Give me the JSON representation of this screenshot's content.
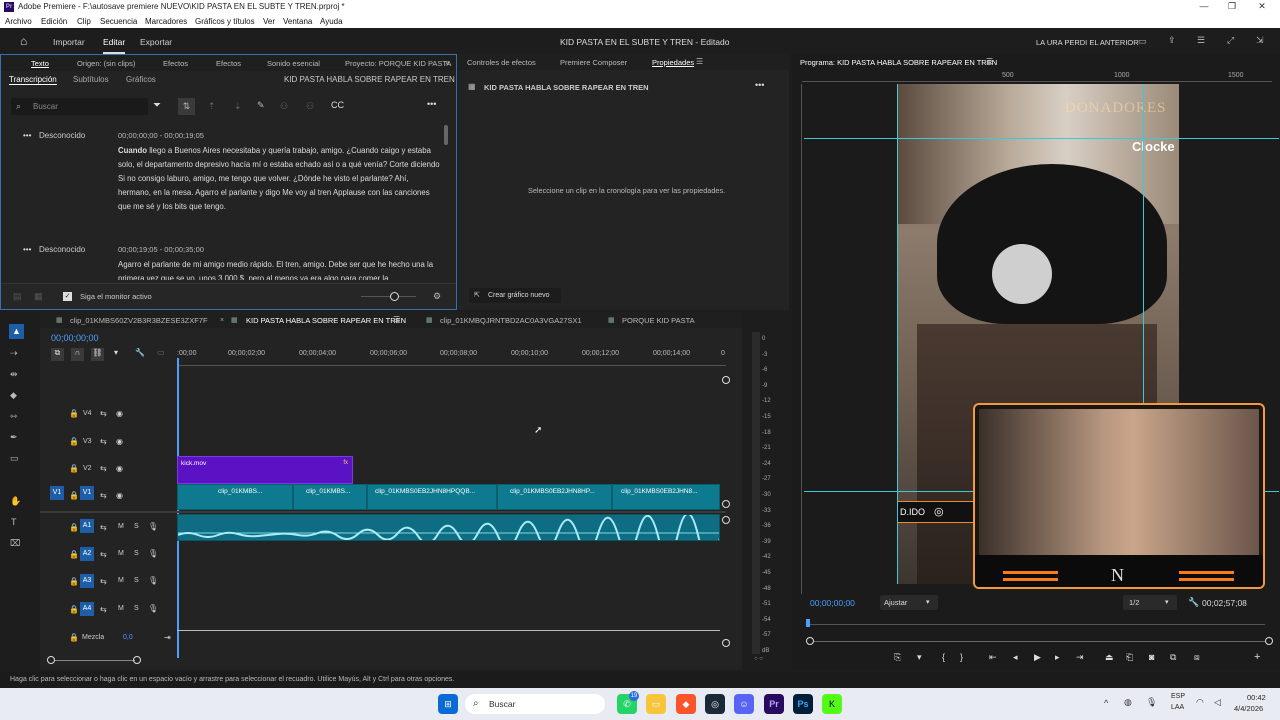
{
  "window": {
    "app_title": "Adobe Premiere - F:\\autosave premiere NUEVO\\KID PASTA EN EL SUBTE Y TREN.prproj *",
    "app_icon": "Pr"
  },
  "menu": [
    "Archivo",
    "Edición",
    "Clip",
    "Secuencia",
    "Marcadores",
    "Gráficos y títulos",
    "Ver",
    "Ventana",
    "Ayuda"
  ],
  "header": {
    "tabs": [
      "Importar",
      "Editar",
      "Exportar"
    ],
    "active_tab": "Editar",
    "project_title": "KID PASTA EN EL SUBTE Y TREN - Editado",
    "right_label": "LA URA PERDI EL ANTERIOR"
  },
  "text_panel": {
    "tabs": [
      "Texto",
      "Origen: (sin clips)",
      "Efectos",
      "Sonido esencial",
      "Proyecto: PORQUE KID PASTA"
    ],
    "subtabs": [
      "Transcripción",
      "Subtítulos",
      "Gráficos"
    ],
    "sequence_name": "KID PASTA HABLA SOBRE RAPEAR EN TREN",
    "search_placeholder": "Buscar",
    "entries": [
      {
        "speaker": "Desconocido",
        "time": "00;00;00;00 - 00;00;19;05",
        "bold": "Cuando",
        "text": " llego a Buenos Aires necesitaba y quería trabajo, amigo. ¿Cuando caigo y estaba solo, el departamento depresivo hacía mí o estaba echado así o a qué venía? Corte diciendo Si no consigo laburo, amigo, me tengo que volver. ¿Dónde he visto el parlante? Ahí, hermano, en la mesa. Agarro el parlante y digo Me voy al tren Applause con las canciones que me sé y los bits que tengo."
      },
      {
        "speaker": "Desconocido",
        "time": "00;00;19;05 - 00;00;35;00",
        "bold": "",
        "text": "Agarro el parlante de mi amigo medio rápido. El tren, amigo. Debe ser que he hecho una la primera vez que se vo, unos 3.000 $, pero al menos ya era algo para comer la"
      }
    ],
    "monitor_checkbox": "Siga el monitor activo"
  },
  "props_panel": {
    "tabs": [
      "Controles de efectos",
      "Premiere Composer",
      "Propiedades"
    ],
    "header": "KID PASTA HABLA SOBRE RAPEAR EN TREN",
    "empty_msg": "Seleccione un clip en la cronología para ver las propiedades.",
    "new_graphic": "Crear gráfico nuevo"
  },
  "program": {
    "tab": "Programa: KID PASTA HABLA SOBRE RAPEAR EN TREN",
    "ruler": [
      "500",
      "1000",
      "1500"
    ],
    "timecode": "00;00;00;00",
    "fit": "Ajustar",
    "quality": "1/2",
    "duration": "00;02;57;08",
    "overlay_donadores": "DONADORES",
    "overlay_clocke": "Clocke",
    "overlay_handle": "D.IDO",
    "overlay_logo": "N"
  },
  "timeline": {
    "tabs": [
      "clip_01KMBS60ZV2B3R3BZESE3ZXF7F",
      "KID PASTA HABLA SOBRE RAPEAR EN TREN",
      "clip_01KMBQJRNTBD2AC0A3VGA27SX1",
      "PORQUE KID PASTA"
    ],
    "active_tab": "KID PASTA HABLA SOBRE RAPEAR EN TREN",
    "timecode": "00;00;00;00",
    "ruler": [
      ":00;00",
      "00;00;02;00",
      "00;00;04;00",
      "00;00;06;00",
      "00;00;08;00",
      "00;00;10;00",
      "00;00;12;00",
      "00;00;14;00"
    ],
    "tracks_video": [
      "V4",
      "V3",
      "V2",
      "V1"
    ],
    "tracks_audio": [
      "A1",
      "A2",
      "A3",
      "A4"
    ],
    "source_v": "V1",
    "mix_label": "Mezcla",
    "mix_value": "0,0",
    "v2_clip": "kick.mov",
    "v1_clips": [
      "clip_01KMBS...",
      "clip_01KMBS...",
      "clip_01KMBS0EB2JHN8HPQQB...",
      "clip_01KMBS0EB2JHN8HP...",
      "clip_01KMBS0EB2JHN8..."
    ],
    "meter_scale": [
      "0",
      "-3",
      "-6",
      "-9",
      "-12",
      "-15",
      "-18",
      "-21",
      "-24",
      "-27",
      "-30",
      "-33",
      "-36",
      "-39",
      "-42",
      "-45",
      "-48",
      "-51",
      "-54",
      "-57",
      "dB"
    ]
  },
  "status": "Haga clic para seleccionar o haga clic en un espacio vacío y arrastre para seleccionar el recuadro. Utilice Mayús, Alt y Ctrl para otras opciones.",
  "taskbar": {
    "search": "Buscar",
    "lang1": "ESP",
    "lang2": "LAA",
    "time": "00:42",
    "date": "4/4/2026",
    "badge": "19"
  }
}
